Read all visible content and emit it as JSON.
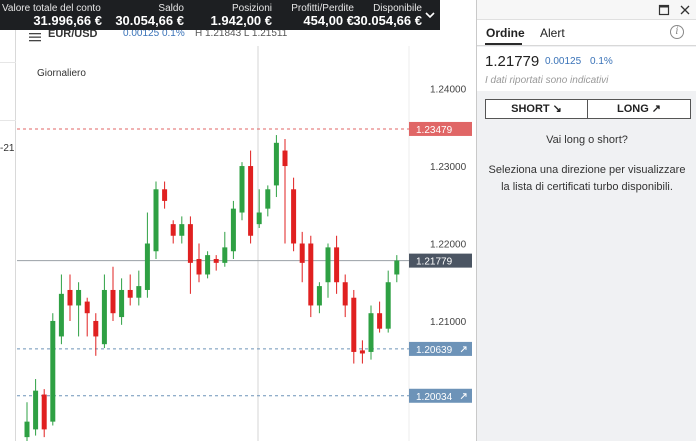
{
  "account_bar": {
    "items": [
      {
        "label": "Valore totale del conto",
        "value": "31.996,66 €"
      },
      {
        "label": "Saldo",
        "value": "30.054,66 €"
      },
      {
        "label": "Posizioni",
        "value": "1.942,00 €"
      },
      {
        "label": "Profitti/Perdite",
        "value": "454,00 €"
      },
      {
        "label": "Disponibile",
        "value": "30.054,66 €"
      }
    ],
    "chevron_icon": "chevron-down-icon"
  },
  "gutter": {
    "partial_value": "-21"
  },
  "chart_header": {
    "symbol": "EUR/USD",
    "change": "0.00125",
    "change_pct": "0.1%",
    "high_low": "H 1.21843 L 1.21511"
  },
  "chart": {
    "period_label": "Giornaliero",
    "y_ticks": [
      "1.24000",
      "1.23000",
      "1.22000",
      "1.21000"
    ],
    "current_price_label": "1.21779",
    "level_red_label": "1.23479",
    "level_blue1_label": "1.20639",
    "level_blue2_label": "1.20034",
    "colors": {
      "up": "#2ea043",
      "down": "#e02020",
      "red_level": "#e06666",
      "blue_level": "#6d93b8",
      "current": "#4b5563"
    }
  },
  "chart_data": {
    "type": "candlestick",
    "title": "",
    "ylim": [
      1.1945,
      1.2455
    ],
    "y_ticks": [
      1.24,
      1.23,
      1.22,
      1.21
    ],
    "candles": [
      {
        "o": 1.195,
        "c": 1.197,
        "h": 1.1995,
        "l": 1.1945
      },
      {
        "o": 1.196,
        "c": 1.201,
        "h": 1.2025,
        "l": 1.1952
      },
      {
        "o": 1.2005,
        "c": 1.196,
        "h": 1.2012,
        "l": 1.195
      },
      {
        "o": 1.197,
        "c": 1.21,
        "h": 1.211,
        "l": 1.1965
      },
      {
        "o": 1.208,
        "c": 1.2135,
        "h": 1.216,
        "l": 1.207
      },
      {
        "o": 1.214,
        "c": 1.212,
        "h": 1.216,
        "l": 1.21
      },
      {
        "o": 1.212,
        "c": 1.214,
        "h": 1.215,
        "l": 1.208
      },
      {
        "o": 1.2125,
        "c": 1.211,
        "h": 1.213,
        "l": 1.208
      },
      {
        "o": 1.21,
        "c": 1.208,
        "h": 1.211,
        "l": 1.2055
      },
      {
        "o": 1.207,
        "c": 1.214,
        "h": 1.216,
        "l": 1.2065
      },
      {
        "o": 1.214,
        "c": 1.211,
        "h": 1.217,
        "l": 1.21
      },
      {
        "o": 1.2105,
        "c": 1.214,
        "h": 1.2155,
        "l": 1.2095
      },
      {
        "o": 1.214,
        "c": 1.213,
        "h": 1.216,
        "l": 1.212
      },
      {
        "o": 1.213,
        "c": 1.2145,
        "h": 1.2165,
        "l": 1.212
      },
      {
        "o": 1.214,
        "c": 1.22,
        "h": 1.224,
        "l": 1.213
      },
      {
        "o": 1.219,
        "c": 1.227,
        "h": 1.228,
        "l": 1.218
      },
      {
        "o": 1.227,
        "c": 1.2255,
        "h": 1.228,
        "l": 1.2245
      },
      {
        "o": 1.2225,
        "c": 1.221,
        "h": 1.223,
        "l": 1.22
      },
      {
        "o": 1.221,
        "c": 1.2225,
        "h": 1.2235,
        "l": 1.22
      },
      {
        "o": 1.2225,
        "c": 1.2175,
        "h": 1.2235,
        "l": 1.2135
      },
      {
        "o": 1.218,
        "c": 1.216,
        "h": 1.22,
        "l": 1.215
      },
      {
        "o": 1.216,
        "c": 1.2185,
        "h": 1.219,
        "l": 1.2155
      },
      {
        "o": 1.218,
        "c": 1.2175,
        "h": 1.2185,
        "l": 1.2165
      },
      {
        "o": 1.2175,
        "c": 1.2195,
        "h": 1.2215,
        "l": 1.217
      },
      {
        "o": 1.219,
        "c": 1.2245,
        "h": 1.2255,
        "l": 1.218
      },
      {
        "o": 1.224,
        "c": 1.23,
        "h": 1.2305,
        "l": 1.223
      },
      {
        "o": 1.23,
        "c": 1.221,
        "h": 1.232,
        "l": 1.22
      },
      {
        "o": 1.2225,
        "c": 1.224,
        "h": 1.227,
        "l": 1.222
      },
      {
        "o": 1.2245,
        "c": 1.227,
        "h": 1.2275,
        "l": 1.2235
      },
      {
        "o": 1.2275,
        "c": 1.233,
        "h": 1.234,
        "l": 1.226
      },
      {
        "o": 1.232,
        "c": 1.23,
        "h": 1.2335,
        "l": 1.22
      },
      {
        "o": 1.227,
        "c": 1.22,
        "h": 1.2285,
        "l": 1.219
      },
      {
        "o": 1.22,
        "c": 1.2175,
        "h": 1.2215,
        "l": 1.215
      },
      {
        "o": 1.22,
        "c": 1.212,
        "h": 1.221,
        "l": 1.2105
      },
      {
        "o": 1.212,
        "c": 1.2145,
        "h": 1.215,
        "l": 1.211
      },
      {
        "o": 1.215,
        "c": 1.2195,
        "h": 1.22,
        "l": 1.213
      },
      {
        "o": 1.2195,
        "c": 1.215,
        "h": 1.221,
        "l": 1.2135
      },
      {
        "o": 1.215,
        "c": 1.212,
        "h": 1.216,
        "l": 1.2105
      },
      {
        "o": 1.213,
        "c": 1.206,
        "h": 1.214,
        "l": 1.2045
      },
      {
        "o": 1.2062,
        "c": 1.2058,
        "h": 1.2075,
        "l": 1.2045
      },
      {
        "o": 1.206,
        "c": 1.211,
        "h": 1.212,
        "l": 1.205
      },
      {
        "o": 1.211,
        "c": 1.209,
        "h": 1.2125,
        "l": 1.2085
      },
      {
        "o": 1.209,
        "c": 1.215,
        "h": 1.2165,
        "l": 1.2085
      },
      {
        "o": 1.216,
        "c": 1.2178,
        "h": 1.2185,
        "l": 1.215
      }
    ],
    "levels": [
      {
        "value": 1.23479,
        "kind": "red"
      },
      {
        "value": 1.20639,
        "kind": "blue"
      },
      {
        "value": 1.20034,
        "kind": "blue"
      }
    ],
    "current": 1.21779
  },
  "panel": {
    "tabs": [
      "Ordine",
      "Alert"
    ],
    "active_tab": "Ordine",
    "info_icon": "info-icon",
    "price": "1.21779",
    "change": "0.00125",
    "change_pct": "0.1%",
    "disclaimer": "I dati riportati sono indicativi",
    "short_label": "SHORT ↘",
    "long_label": "LONG ↗",
    "question": "Vai long o short?",
    "explain": "Seleziona una direzione per visualizzare la lista di certificati turbo disponibili."
  }
}
